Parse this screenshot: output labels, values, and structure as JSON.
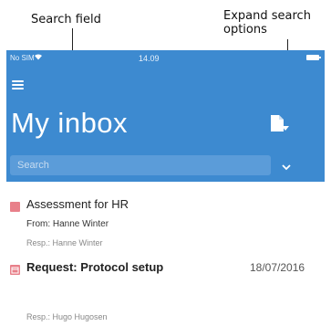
{
  "annotations": {
    "search_field": "Search field",
    "expand_search_options": "Expand search options"
  },
  "status_bar": {
    "carrier": "No SIM",
    "time": "14.09"
  },
  "header": {
    "title": "My inbox",
    "color": "#3d8ad0"
  },
  "search": {
    "placeholder": "Search"
  },
  "items": [
    {
      "title": "Assessment for HR",
      "from": "From: Hanne Winter",
      "resp": "Resp.: Hanne Winter",
      "icon": "task-icon",
      "icon_color": "#e8808a"
    },
    {
      "title": "Request: Protocol setup",
      "date": "18/07/2016",
      "resp": "Resp.: Hugo Hugosen",
      "icon": "calendar-icon",
      "icon_color": "#e8808a"
    }
  ]
}
